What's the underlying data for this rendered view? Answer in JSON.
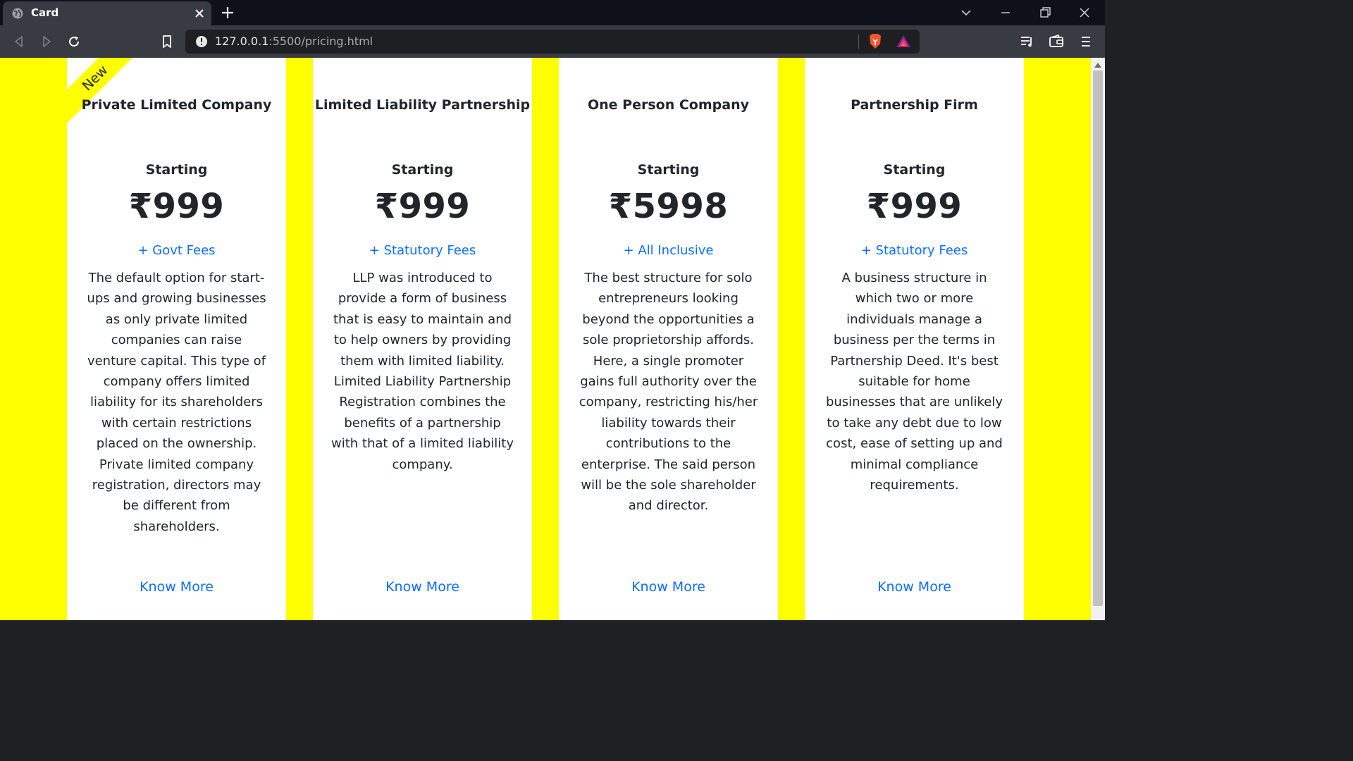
{
  "browser": {
    "tab_title": "Card",
    "url_host": "127.0.0.1",
    "url_path": ":5500/pricing.html"
  },
  "colors": {
    "page_background": "#ffff00",
    "link": "#0d6efd",
    "text": "#212529",
    "card_background": "#ffffff"
  },
  "cards": [
    {
      "title": "Private Limited Company",
      "badge": "New",
      "starting": "Starting",
      "price": "₹999",
      "fees": "+ Govt Fees",
      "description": "The default option for start-ups and growing businesses as only private limited companies can raise venture capital. This type of company offers limited liability for its shareholders with certain restrictions placed on the ownership. Private limited company registration, directors may be different from shareholders.",
      "link": "Know More"
    },
    {
      "title": "Limited Liability Partnership",
      "starting": "Starting",
      "price": "₹999",
      "fees": "+ Statutory Fees",
      "description": "LLP was introduced to provide a form of business that is easy to maintain and to help owners by providing them with limited liability. Limited Liability Partnership Registration combines the benefits of a partnership with that of a limited liability company.",
      "link": "Know More"
    },
    {
      "title": "One Person Company",
      "starting": "Starting",
      "price": "₹5998",
      "fees": "+ All Inclusive",
      "description": "The best structure for solo entrepreneurs looking beyond the opportunities a sole proprietorship affords. Here, a single promoter gains full authority over the company, restricting his/her liability towards their contributions to the enterprise. The said person will be the sole shareholder and director.",
      "link": "Know More"
    },
    {
      "title": "Partnership Firm",
      "starting": "Starting",
      "price": "₹999",
      "fees": "+ Statutory Fees",
      "description": "A business structure in which two or more individuals manage a business per the terms in Partnership Deed. It's best suitable for home businesses that are unlikely to take any debt due to low cost, ease of setting up and minimal compliance requirements.",
      "link": "Know More"
    }
  ]
}
